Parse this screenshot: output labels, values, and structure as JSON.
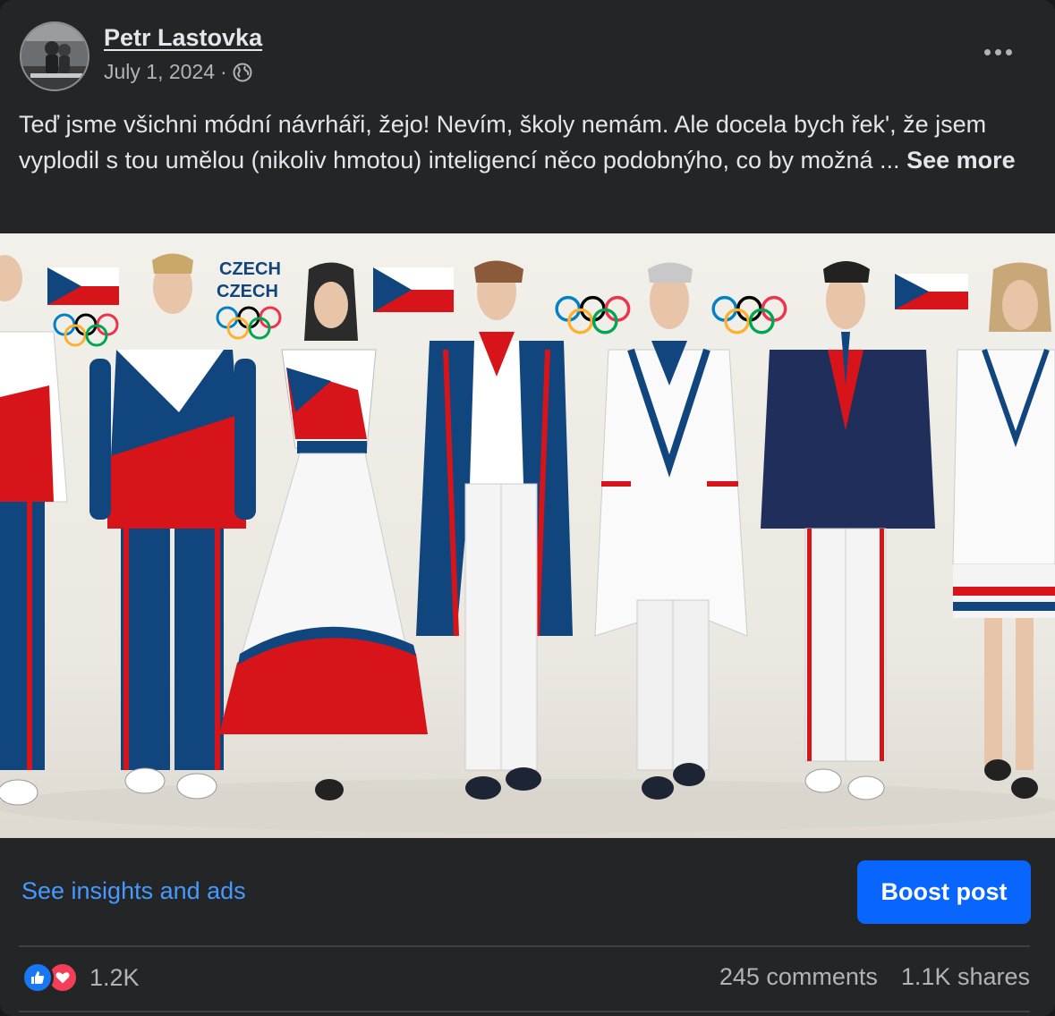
{
  "post": {
    "author": "Petr Lastovka",
    "date": "July 1, 2024",
    "separator": "·",
    "privacy_icon": "globe-icon",
    "text": "Teď jsme všichni módní návrháři, žejo! Nevím, školy nemám. Ale docela bych řek', že jsem vyplodil s tou umělou (nikoliv hmotou) inteligencí něco podobnýho, co by možná ...",
    "see_more": "See more"
  },
  "image": {
    "labels": [
      "CZECH",
      "CZECH"
    ],
    "colors": {
      "red": "#d7141a",
      "blue": "#11457e",
      "white": "#ffffff"
    }
  },
  "footer": {
    "insights_link": "See insights and ads",
    "boost_button": "Boost post",
    "reaction_count": "1.2K",
    "comments": "245 comments",
    "shares": "1.1K shares"
  },
  "colors": {
    "accent": "#0866ff",
    "link": "#4599ff",
    "background": "#242526"
  }
}
